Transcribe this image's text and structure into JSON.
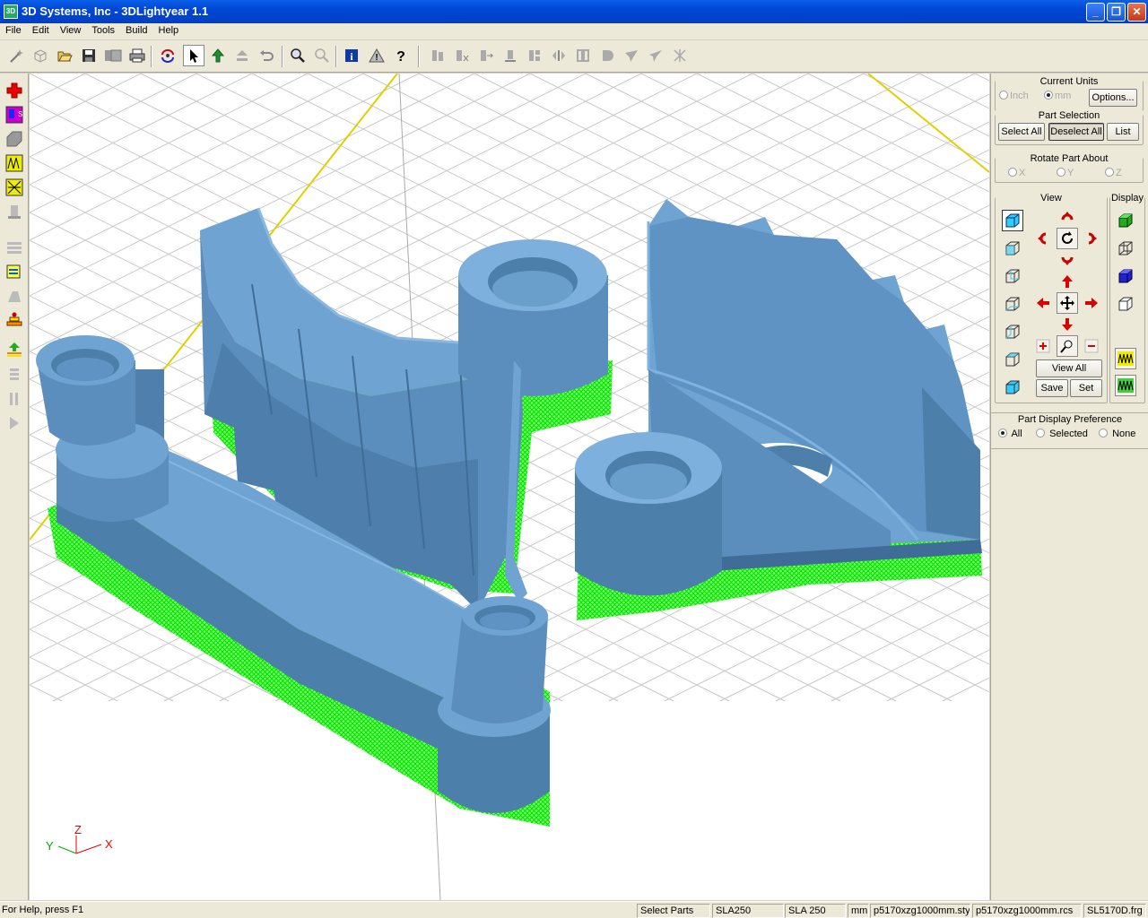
{
  "window": {
    "title": "3D Systems, Inc - 3DLightyear 1.1"
  },
  "menu": [
    "File",
    "Edit",
    "View",
    "Tools",
    "Build",
    "Help"
  ],
  "toolbar_icons": [
    "magic-wand-icon",
    "cube-icon",
    "open-folder-icon",
    "save-icon",
    "save-all-icon",
    "print-icon",
    "sync-icon",
    "pointer-icon",
    "move-up-icon",
    "lift-icon",
    "undo-icon",
    "zoom-icon",
    "zoom-fit-icon",
    "info-icon",
    "warning-icon",
    "help-icon",
    "support-a-icon",
    "support-b-icon",
    "support-c-icon",
    "support-d-icon",
    "support-e-icon",
    "support-f-icon",
    "support-g-icon",
    "support-h-icon",
    "support-i-icon",
    "support-j-icon",
    "support-k-icon"
  ],
  "left_toolbar_icons": [
    "add-part-icon",
    "layout-icon",
    "slice-icon",
    "support-icon",
    "hatch-icon",
    "build-icon",
    "layers-icon",
    "verify-icon",
    "repair-icon",
    "stack-icon",
    "platform-up-icon",
    "pause-icon",
    "stop-icon",
    "play-icon"
  ],
  "axis": {
    "x": "X",
    "y": "Y",
    "z": "Z"
  },
  "panel": {
    "units": {
      "title": "Current Units",
      "opt1": "Inch",
      "opt2": "mm",
      "options_btn": "Options..."
    },
    "selection": {
      "title": "Part Selection",
      "select_all": "Select All",
      "deselect_all": "Deselect All",
      "list": "List"
    },
    "rotate": {
      "title": "Rotate Part About",
      "x": "X",
      "y": "Y",
      "z": "Z"
    },
    "view": {
      "title": "View",
      "view_all": "View All",
      "save": "Save",
      "set": "Set"
    },
    "display": {
      "title": "Display"
    },
    "preference": {
      "title": "Part Display Preference",
      "all": "All",
      "selected": "Selected",
      "none": "None"
    }
  },
  "status": {
    "help": "For Help, press F1",
    "mode": "Select Parts",
    "machine1": "SLA250",
    "machine2": "SLA 250",
    "units": "mm",
    "style": "p5170xzg1000mm.sty",
    "recoat": "p5170xzg1000mm.rcs",
    "resin": "SL5170D.frg"
  },
  "colors": {
    "part": "#6fa4d2",
    "part_dark": "#4d7fab",
    "support": "#00ff00",
    "title": "#0046d5"
  }
}
